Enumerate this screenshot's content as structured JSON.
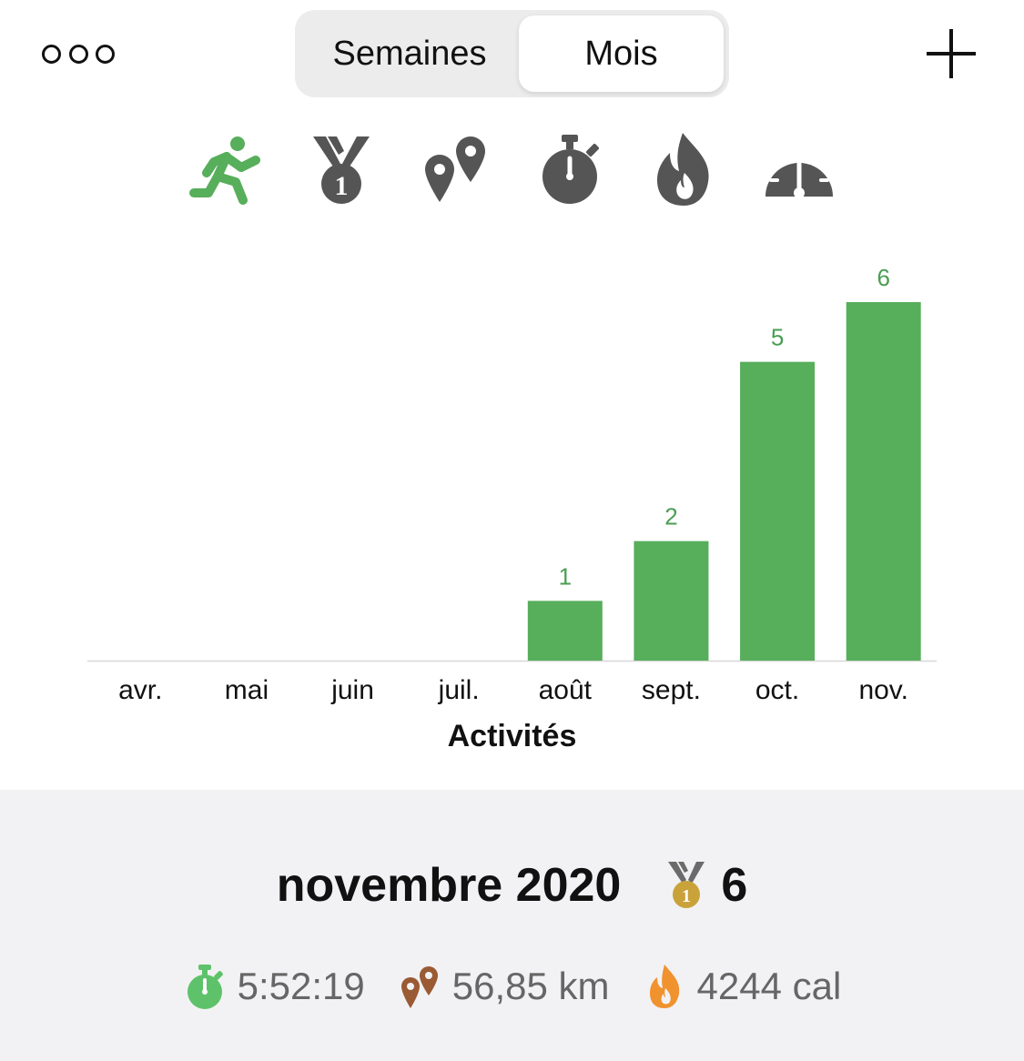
{
  "header": {
    "more_menu_icon": "ellipsis-icon",
    "segments": [
      {
        "label": "Semaines",
        "selected": false
      },
      {
        "label": "Mois",
        "selected": true
      }
    ],
    "add_icon": "plus-icon"
  },
  "metrics": [
    {
      "icon": "running-icon",
      "selected": true
    },
    {
      "icon": "medal-icon",
      "selected": false
    },
    {
      "icon": "distance-pins-icon",
      "selected": false
    },
    {
      "icon": "stopwatch-icon",
      "selected": false
    },
    {
      "icon": "flame-icon",
      "selected": false
    },
    {
      "icon": "speedometer-icon",
      "selected": false
    }
  ],
  "colors": {
    "accent_green": "#57ae5b",
    "icon_gray": "#555555",
    "label_green": "#4a9e52",
    "summary_bg": "#f2f2f4",
    "pin_brown": "#9a5a33",
    "flame_orange": "#f0922e",
    "medal_gold": "#c9a23a"
  },
  "chart_data": {
    "type": "bar",
    "categories": [
      "avr.",
      "mai",
      "juin",
      "juil.",
      "août",
      "sept.",
      "oct.",
      "nov."
    ],
    "values": [
      0,
      0,
      0,
      0,
      1,
      2,
      5,
      6
    ],
    "data_labels": [
      "",
      "",
      "",
      "",
      "1",
      "2",
      "5",
      "6"
    ],
    "title": "Activités",
    "xlabel": "",
    "ylabel": "",
    "ylim": [
      0,
      6
    ],
    "grid": false,
    "legend": "none"
  },
  "summary": {
    "period": "novembre 2020",
    "activities_count": "6",
    "duration": "5:52:19",
    "distance": "56,85 km",
    "calories": "4244 cal"
  }
}
